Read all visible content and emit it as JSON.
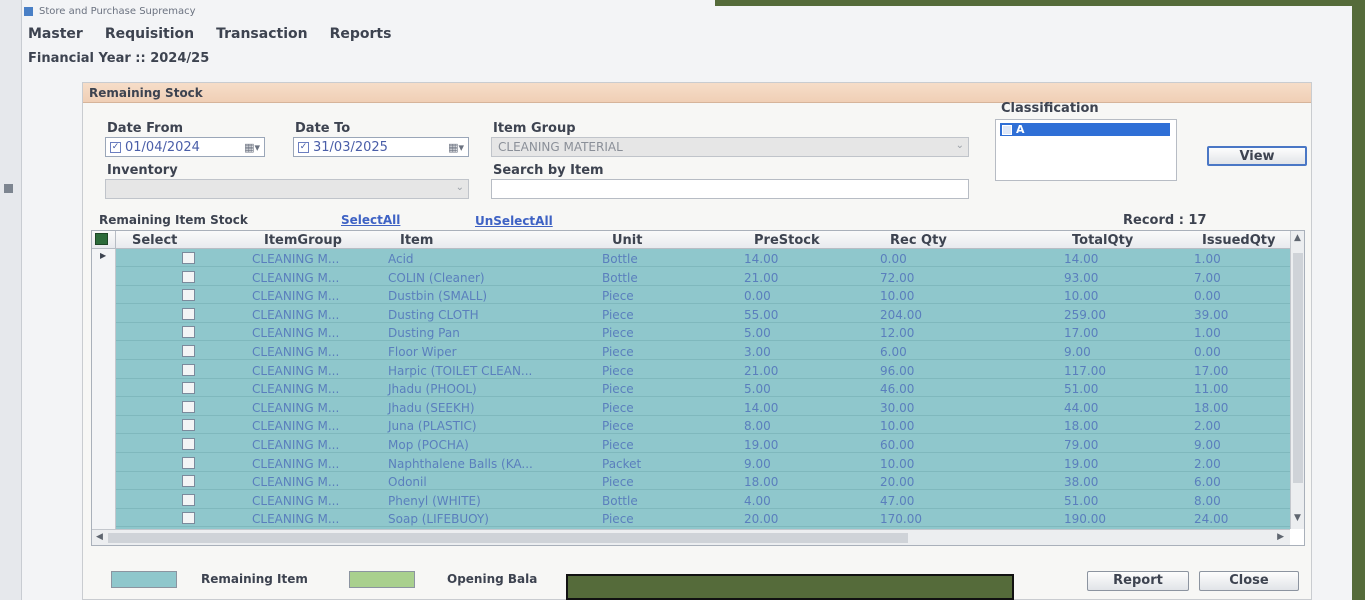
{
  "window": {
    "title": "Store and Purchase Supremacy"
  },
  "menu": [
    "Master",
    "Requisition",
    "Transaction",
    "Reports"
  ],
  "financial_year": {
    "label": "Financial Year ::",
    "value": "2024/25"
  },
  "panel": {
    "title": "Remaining Stock"
  },
  "filters": {
    "date_from_label": "Date From",
    "date_from": "01/04/2024",
    "date_to_label": "Date To",
    "date_to": "31/03/2025",
    "item_group_label": "Item Group",
    "item_group": "CLEANING MATERIAL",
    "inventory_label": "Inventory",
    "search_label": "Search by Item",
    "search_value": "",
    "classification_label": "Classification",
    "classification_selected": "A",
    "view_button": "View"
  },
  "grid_toolbar": {
    "title": "Remaining Item Stock",
    "select_all": "SelectAll",
    "unselect_all": "UnSelectAll",
    "record_label": "Record : 17"
  },
  "columns": [
    "Select",
    "ItemGroup",
    "Item",
    "Unit",
    "PreStock",
    "Rec Qty",
    "TotalQty",
    "IssuedQty"
  ],
  "rows": [
    {
      "group": "CLEANING M...",
      "item": "Acid",
      "unit": "Bottle",
      "pre": "14.00",
      "rec": "0.00",
      "total": "14.00",
      "issued": "1.00"
    },
    {
      "group": "CLEANING M...",
      "item": "COLIN (Cleaner)",
      "unit": "Bottle",
      "pre": "21.00",
      "rec": "72.00",
      "total": "93.00",
      "issued": "7.00"
    },
    {
      "group": "CLEANING M...",
      "item": "Dustbin (SMALL)",
      "unit": "Piece",
      "pre": "0.00",
      "rec": "10.00",
      "total": "10.00",
      "issued": "0.00"
    },
    {
      "group": "CLEANING M...",
      "item": "Dusting CLOTH",
      "unit": "Piece",
      "pre": "55.00",
      "rec": "204.00",
      "total": "259.00",
      "issued": "39.00"
    },
    {
      "group": "CLEANING M...",
      "item": "Dusting Pan",
      "unit": "Piece",
      "pre": "5.00",
      "rec": "12.00",
      "total": "17.00",
      "issued": "1.00"
    },
    {
      "group": "CLEANING M...",
      "item": "Floor Wiper",
      "unit": "Piece",
      "pre": "3.00",
      "rec": "6.00",
      "total": "9.00",
      "issued": "0.00"
    },
    {
      "group": "CLEANING M...",
      "item": "Harpic (TOILET CLEAN...",
      "unit": "Piece",
      "pre": "21.00",
      "rec": "96.00",
      "total": "117.00",
      "issued": "17.00"
    },
    {
      "group": "CLEANING M...",
      "item": "Jhadu (PHOOL)",
      "unit": "Piece",
      "pre": "5.00",
      "rec": "46.00",
      "total": "51.00",
      "issued": "11.00"
    },
    {
      "group": "CLEANING M...",
      "item": "Jhadu (SEEKH)",
      "unit": "Piece",
      "pre": "14.00",
      "rec": "30.00",
      "total": "44.00",
      "issued": "18.00"
    },
    {
      "group": "CLEANING M...",
      "item": "Juna (PLASTIC)",
      "unit": "Piece",
      "pre": "8.00",
      "rec": "10.00",
      "total": "18.00",
      "issued": "2.00"
    },
    {
      "group": "CLEANING M...",
      "item": "Mop (POCHA)",
      "unit": "Piece",
      "pre": "19.00",
      "rec": "60.00",
      "total": "79.00",
      "issued": "9.00"
    },
    {
      "group": "CLEANING M...",
      "item": "Naphthalene Balls (KA...",
      "unit": "Packet",
      "pre": "9.00",
      "rec": "10.00",
      "total": "19.00",
      "issued": "2.00"
    },
    {
      "group": "CLEANING M...",
      "item": "Odonil",
      "unit": "Piece",
      "pre": "18.00",
      "rec": "20.00",
      "total": "38.00",
      "issued": "6.00"
    },
    {
      "group": "CLEANING M...",
      "item": "Phenyl (WHITE)",
      "unit": "Bottle",
      "pre": "4.00",
      "rec": "47.00",
      "total": "51.00",
      "issued": "8.00"
    },
    {
      "group": "CLEANING M...",
      "item": "Soap (LIFEBUOY)",
      "unit": "Piece",
      "pre": "20.00",
      "rec": "170.00",
      "total": "190.00",
      "issued": "24.00"
    }
  ],
  "footer": {
    "legend_remaining": "Remaining Item",
    "legend_opening": "Opening Bala",
    "report_button": "Report",
    "close_button": "Close"
  },
  "colors": {
    "remaining": "#8fc7cc",
    "opening": "#a9d08e",
    "overlay": "#556b3a"
  }
}
